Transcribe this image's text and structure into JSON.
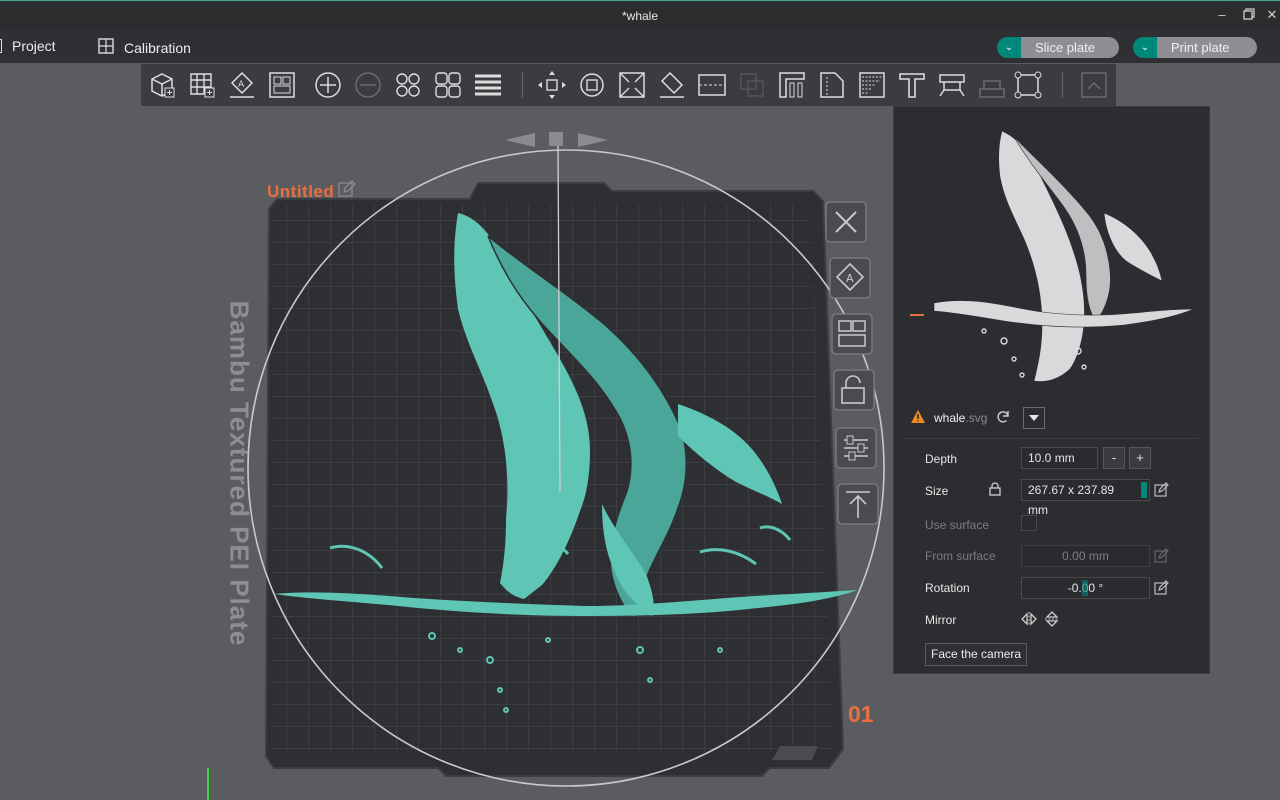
{
  "window": {
    "title": "*whale",
    "controls": [
      "minimize-icon",
      "restore-icon",
      "close-icon"
    ]
  },
  "menubar": {
    "project_label": "Project",
    "calibration_label": "Calibration",
    "slice_label": "Slice plate",
    "print_label": "Print plate"
  },
  "toolbar": {
    "tools": [
      "add-object-icon",
      "add-plate-icon",
      "auto-orient-icon",
      "arrange-icon",
      "split-objects-icon",
      "split-parts-icon",
      "layers-variable-icon",
      "plate-settings-icon",
      "layers-icon",
      "move-icon",
      "rotate-icon",
      "scale-icon",
      "lay-on-face-icon",
      "cut-icon",
      "boolean-icon",
      "support-paint-icon",
      "seam-paint-icon",
      "color-paint-icon",
      "text-icon",
      "measure-icon",
      "assembly-icon",
      "fit-view-icon",
      "collapse-toolbar-icon"
    ]
  },
  "viewport": {
    "plate_name": "Untitled",
    "plate_label": "Bambu Textured PEI Plate",
    "plate_number": "01",
    "accent": "#e8703f",
    "model_color": "#5fc5b5",
    "side_tools": [
      "close-plate-icon",
      "auto-orient-plate-icon",
      "arrange-plate-icon",
      "lock-plate-icon",
      "plate-settings-icon",
      "move-to-top-icon"
    ]
  },
  "panel": {
    "file": {
      "name": "whale",
      "ext": ".svg"
    },
    "depth": {
      "label": "Depth",
      "value": "10.0 mm",
      "minus": "-",
      "plus": "+"
    },
    "size": {
      "label": "Size",
      "value": "267.67 x 237.89 mm"
    },
    "use_surface": {
      "label": "Use surface"
    },
    "from_surface": {
      "label": "From surface",
      "value": "0.00 mm"
    },
    "rotation": {
      "label": "Rotation",
      "value": "-0.00 °"
    },
    "mirror": {
      "label": "Mirror"
    },
    "face_camera_label": "Face the camera"
  },
  "colors": {
    "accent_green": "#00897b",
    "warning": "#f08a24"
  }
}
